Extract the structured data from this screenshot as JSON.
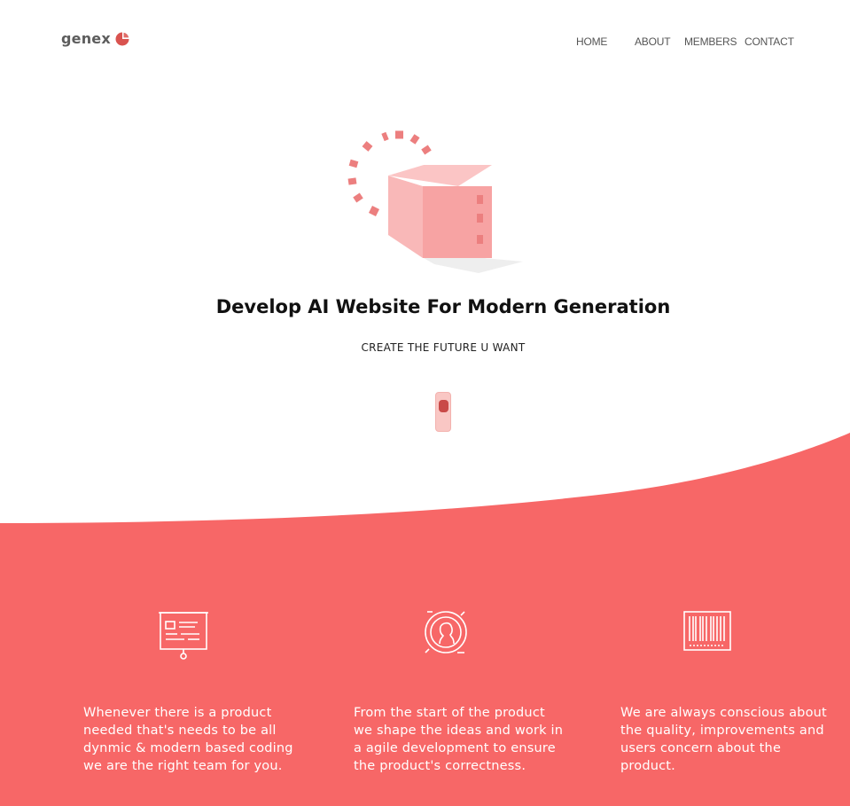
{
  "header": {
    "logo_text": "genex",
    "nav": [
      {
        "label": "HOME"
      },
      {
        "label": "ABOUT"
      },
      {
        "label": "MEMBERS"
      },
      {
        "label": "CONTACT"
      }
    ]
  },
  "hero": {
    "illustration_icon": "loading-cube-icon",
    "title": "Develop AI Website For Modern Generation",
    "subtitle": "CREATE THE FUTURE U WANT",
    "scroll_icon": "scroll-mouse-icon"
  },
  "features": [
    {
      "icon": "presentation-board-icon",
      "text": "Whenever there is a product needed that's needs to be all dynmic & modern based coding we are the right team for you."
    },
    {
      "icon": "coin-profile-icon",
      "text": "From the start of the product we shape the ideas and work in a agile development to ensure the product's correctness."
    },
    {
      "icon": "barcode-icon",
      "text": "We are always conscious about the quality, improvements and users concern about the product."
    }
  ],
  "colors": {
    "accent": "#f76767",
    "logo_mark": "#d9534f",
    "cube_front": "#f7a3a3",
    "cube_side": "#f9b8b8",
    "dashes": "#ec7f7f"
  }
}
